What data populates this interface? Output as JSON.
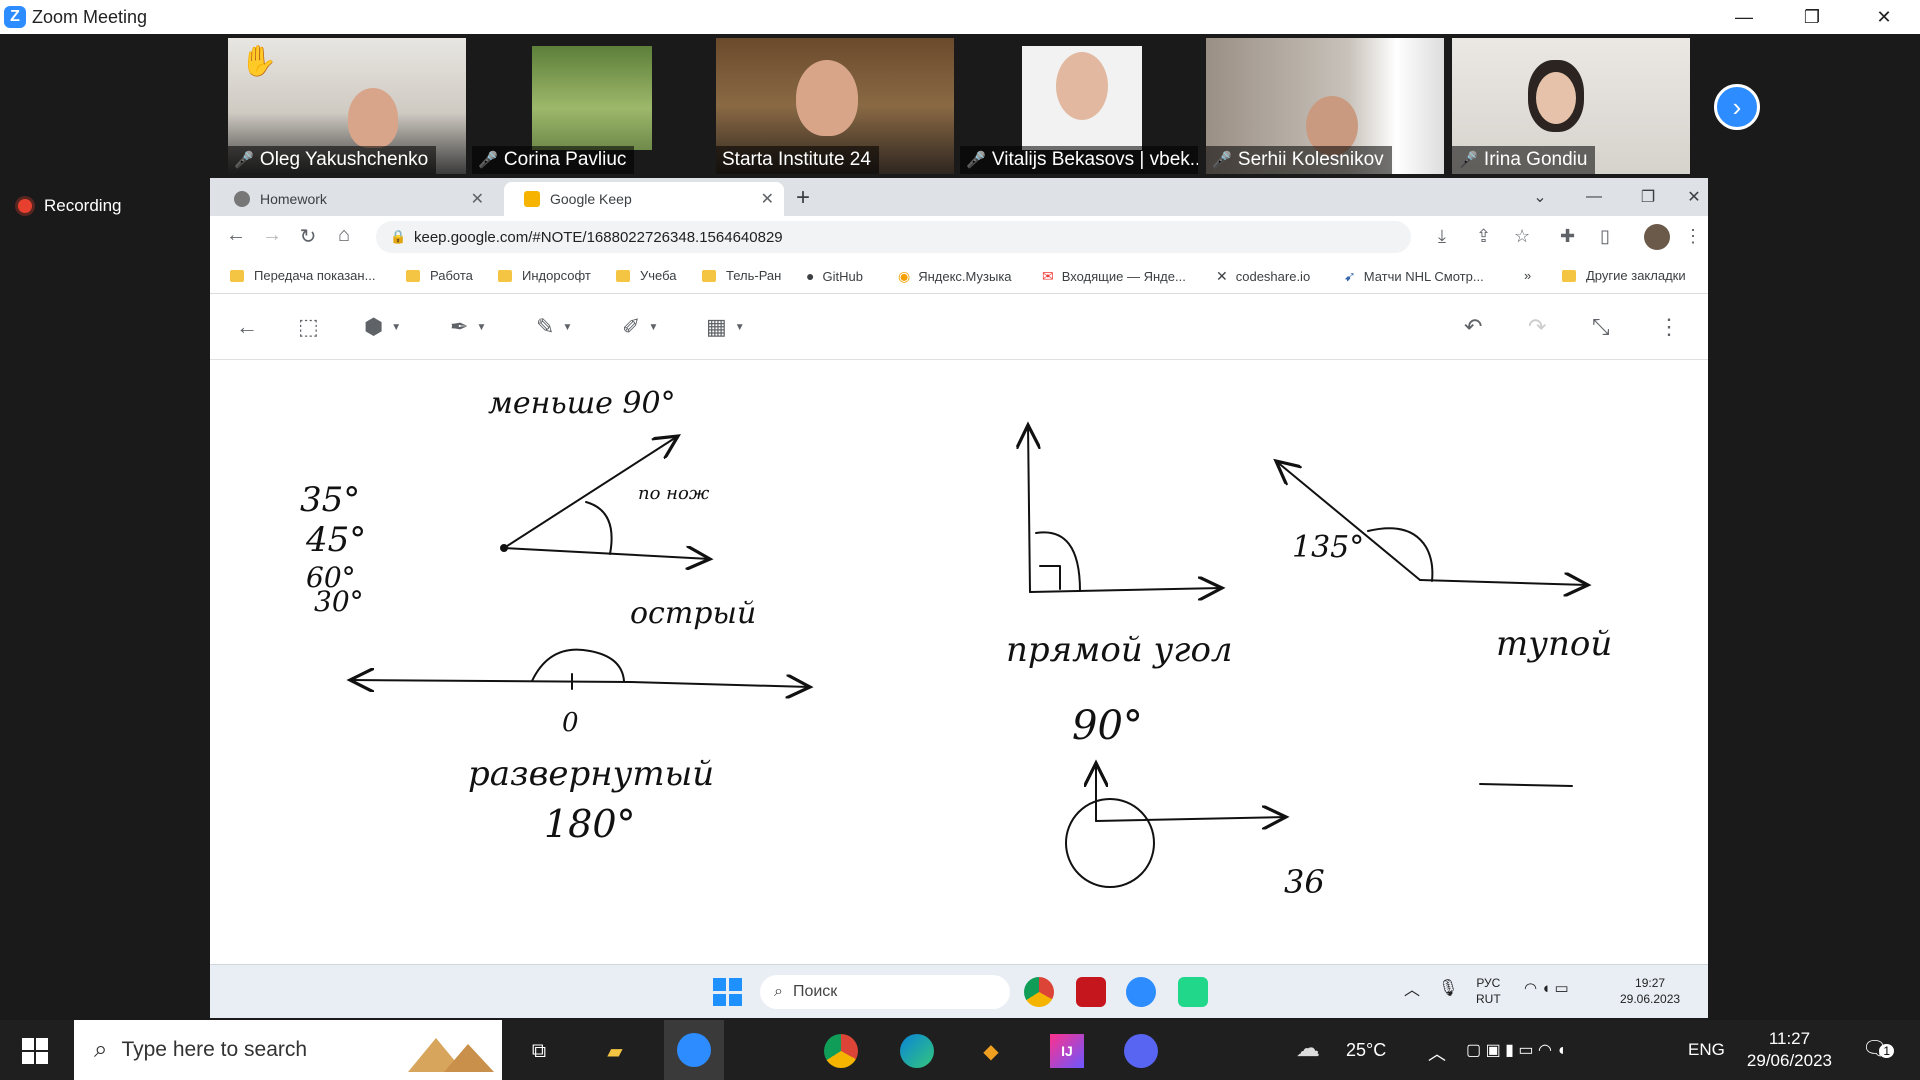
{
  "zoom": {
    "window_title": "Zoom Meeting",
    "recording_label": "Recording",
    "participants": [
      {
        "name": "Oleg Yakushchenko"
      },
      {
        "name": "Corina Pavliuc"
      },
      {
        "name": "Starta Institute 24"
      },
      {
        "name": "Vitalijs Bekasovs | vbek..."
      },
      {
        "name": "Serhii Kolesnikov"
      },
      {
        "name": "Irina Gondiu"
      }
    ]
  },
  "browser": {
    "tabs": [
      {
        "label": "Homework",
        "icon": "github-icon"
      },
      {
        "label": "Google Keep",
        "icon": "keep-icon"
      }
    ],
    "url": "keep.google.com/#NOTE/1688022726348.1564640829",
    "bookmarks": [
      "Передача показан...",
      "Работа",
      "Индорсофт",
      "Учеба",
      "Тель-Ран",
      "GitHub",
      "Яндекс.Музыка",
      "Входящие — Янде...",
      "codeshare.io",
      "Матчи NHL Смотр..."
    ],
    "bookmarks_more": "»",
    "other_bookmarks": "Другие закладки"
  },
  "drawing": {
    "texts": [
      "меньше 90°",
      "35°",
      "45°",
      "60°",
      "30°",
      "по нож",
      "острый",
      "0",
      "развернутый",
      "180°",
      "прямой угол",
      "90°",
      "135°",
      "тупой",
      "36"
    ]
  },
  "inner_taskbar": {
    "search_placeholder": "Поиск",
    "lang_top": "РУС",
    "lang_bottom": "RUT",
    "time": "19:27",
    "date": "29.06.2023"
  },
  "taskbar": {
    "search_placeholder": "Type here to search",
    "weather": "25°C",
    "lang": "ENG",
    "time": "11:27",
    "date": "29/06/2023",
    "notifications": "1"
  },
  "colors": {
    "zoom_blue": "#2d8cff",
    "active_speaker": "#9bd34a",
    "record_red": "#e8402f"
  }
}
